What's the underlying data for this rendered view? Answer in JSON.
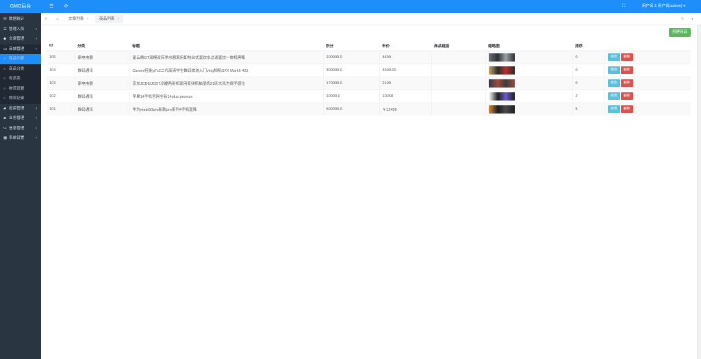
{
  "brand": "GMO后台",
  "colors": {
    "primary": "#1e8ffa",
    "sidebar": "#2a3542",
    "success": "#5cb85c",
    "info": "#5bc0de",
    "danger": "#d9534f"
  },
  "sidebar": {
    "items": [
      {
        "label": "数据统计",
        "icon": "dashboard-icon"
      },
      {
        "label": "管理人员",
        "icon": "list-icon"
      },
      {
        "label": "文章管理",
        "icon": "tag-icon"
      },
      {
        "label": "商城管理",
        "icon": "laptop-icon"
      }
    ],
    "sub_items": [
      {
        "label": "商品列表"
      },
      {
        "label": "商品分类"
      },
      {
        "label": "有货卖"
      },
      {
        "label": "物流设置"
      },
      {
        "label": "物流记录"
      }
    ],
    "items_after": [
      {
        "label": "投资管理",
        "icon": "folder-icon"
      },
      {
        "label": "业务管理",
        "icon": "folder-icon"
      },
      {
        "label": "信息管理",
        "icon": "share-icon"
      },
      {
        "label": "系统设置",
        "icon": "calendar-icon"
      }
    ]
  },
  "topbar": {
    "menu_icon": "☰",
    "refresh_icon": "⟳",
    "fullscreen_icon": "⛶",
    "user_label": "用户名:1 用户名(admin)"
  },
  "tabs": [
    {
      "label": "文章列表"
    },
    {
      "label": "商品列表"
    }
  ],
  "main": {
    "create_button": "创建商品",
    "columns": [
      "ID",
      "分类",
      "标题",
      "积分",
      "市价",
      "商品链接",
      "缩略图",
      "排序",
      ""
    ],
    "rows": [
      {
        "id": "105",
        "category": "家电电器",
        "title": "星云鼎GT双模双床净水器家用即热台式直饮水过滤直饮一体机黑莓",
        "points": "100000.0",
        "price": "4499",
        "link": "",
        "sort": "0",
        "thumb": [
          "#6b6f73",
          "#2d2f33",
          "#9aa0a6"
        ]
      },
      {
        "id": "104",
        "category": "数码通讯",
        "title": "Canon/佳能g7x2二代高清学生数码旅游入门vlog相机G7X MarkII 431",
        "points": "300000.0",
        "price": "4699.00",
        "link": "",
        "sort": "0",
        "thumb": [
          "#c9a46b",
          "#2b2b2b",
          "#b3302f"
        ]
      },
      {
        "id": "103",
        "category": "家电电器",
        "title": "京东JCD6/JCD7冷暖两用机家用变频机抽湿机21匹大风力保手感位",
        "points": "170000.0",
        "price": "2199",
        "link": "",
        "sort": "0",
        "thumb": [
          "#2f3a45",
          "#a04a3a",
          "#3b3b3b"
        ]
      },
      {
        "id": "102",
        "category": "数码通讯",
        "title": "苹果14手机官网全新14plus promax",
        "points": "10000.0",
        "price": "10258",
        "link": "",
        "sort": "2",
        "thumb": [
          "#ffffff",
          "#1d1d1f",
          "#6a5acd"
        ]
      },
      {
        "id": "101",
        "category": "数码通讯",
        "title": "华为mate50pro新款pro系列4手机直降",
        "points": "500000.0",
        "price": "￥12499",
        "link": "",
        "sort": "5",
        "thumb": [
          "#d98a3a",
          "#1e1e1e",
          "#4a4a4a"
        ]
      }
    ],
    "edit_label": "修改",
    "delete_label": "删除"
  }
}
